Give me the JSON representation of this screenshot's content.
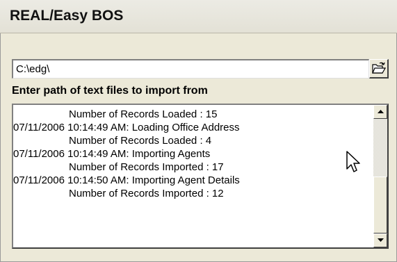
{
  "window": {
    "title": "REAL/Easy BOS"
  },
  "import": {
    "path_value": "C:\\edg\\",
    "path_label": "Enter path of text files to import from",
    "browse_icon": "open-folder-icon"
  },
  "log": {
    "lines": [
      {
        "text": "Number of Records Loaded : 15",
        "indent": true
      },
      {
        "text": "07/11/2006 10:14:49 AM: Loading Office Address",
        "indent": false
      },
      {
        "text": "Number of Records Loaded : 4",
        "indent": true
      },
      {
        "text": "07/11/2006 10:14:49 AM: Importing Agents",
        "indent": false
      },
      {
        "text": "Number of Records Imported : 17",
        "indent": true
      },
      {
        "text": "07/11/2006 10:14:50 AM: Importing Agent Details",
        "indent": false
      },
      {
        "text": "Number of Records Imported : 12",
        "indent": true
      }
    ],
    "scroll_icons": [
      "arrow-up-icon",
      "arrow-down-icon"
    ]
  },
  "colors": {
    "face": "#ece9d8",
    "field_bg": "#ffffff",
    "text": "#000000"
  }
}
